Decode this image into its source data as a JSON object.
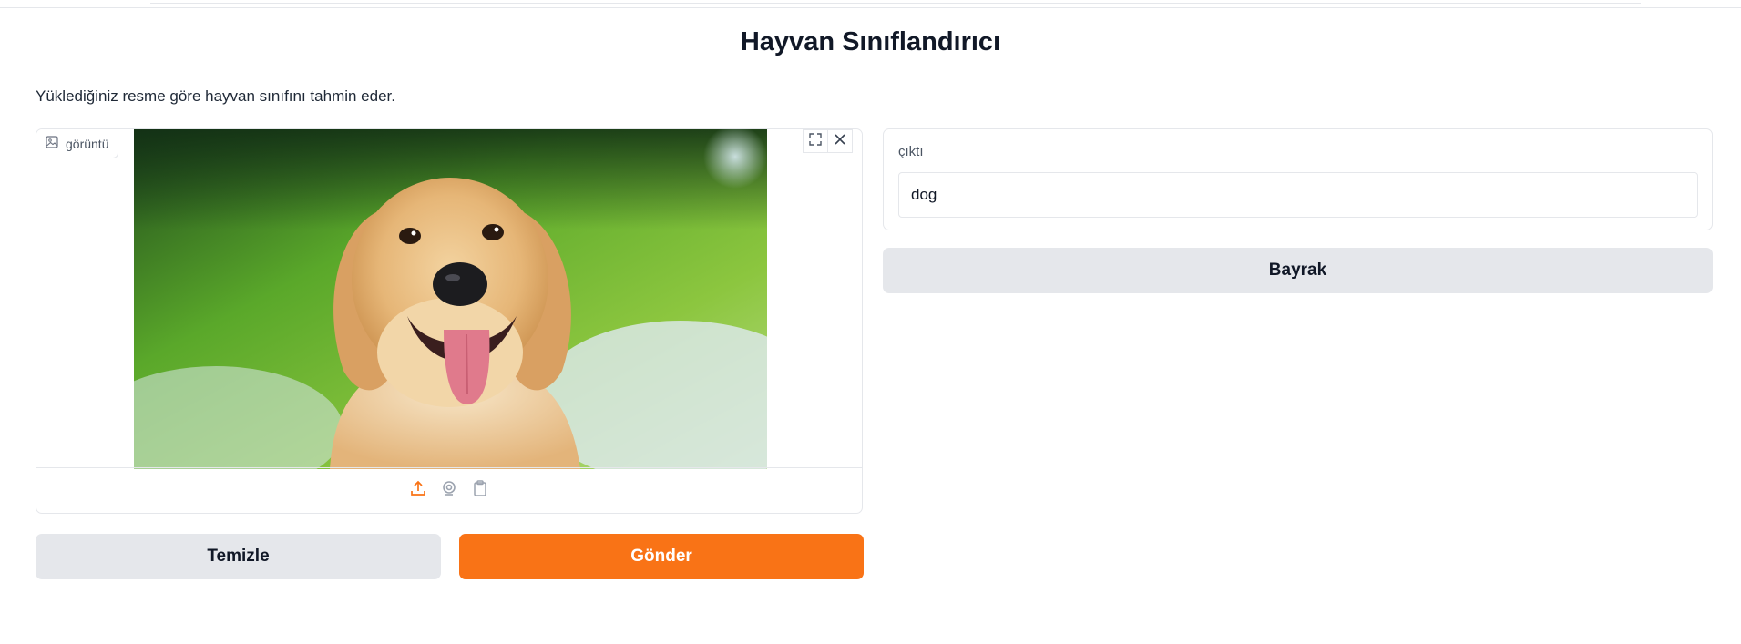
{
  "header": {
    "title": "Hayvan Sınıflandırıcı",
    "description": "Yüklediğiniz resme göre hayvan sınıfını tahmin eder."
  },
  "image_input": {
    "label": "görüntü",
    "icon": "image-icon",
    "tools": [
      "fullscreen-icon",
      "close-icon"
    ],
    "sources": [
      "upload-icon",
      "webcam-icon",
      "clipboard-icon"
    ],
    "active_source": "upload-icon",
    "photo_subject": "golden-retriever-photo"
  },
  "buttons": {
    "clear": "Temizle",
    "submit": "Gönder",
    "flag": "Bayrak"
  },
  "output": {
    "label": "çıktı",
    "value": "dog"
  },
  "colors": {
    "accent": "#f97316",
    "secondary_button": "#e5e7eb",
    "border": "#e5e7eb"
  }
}
